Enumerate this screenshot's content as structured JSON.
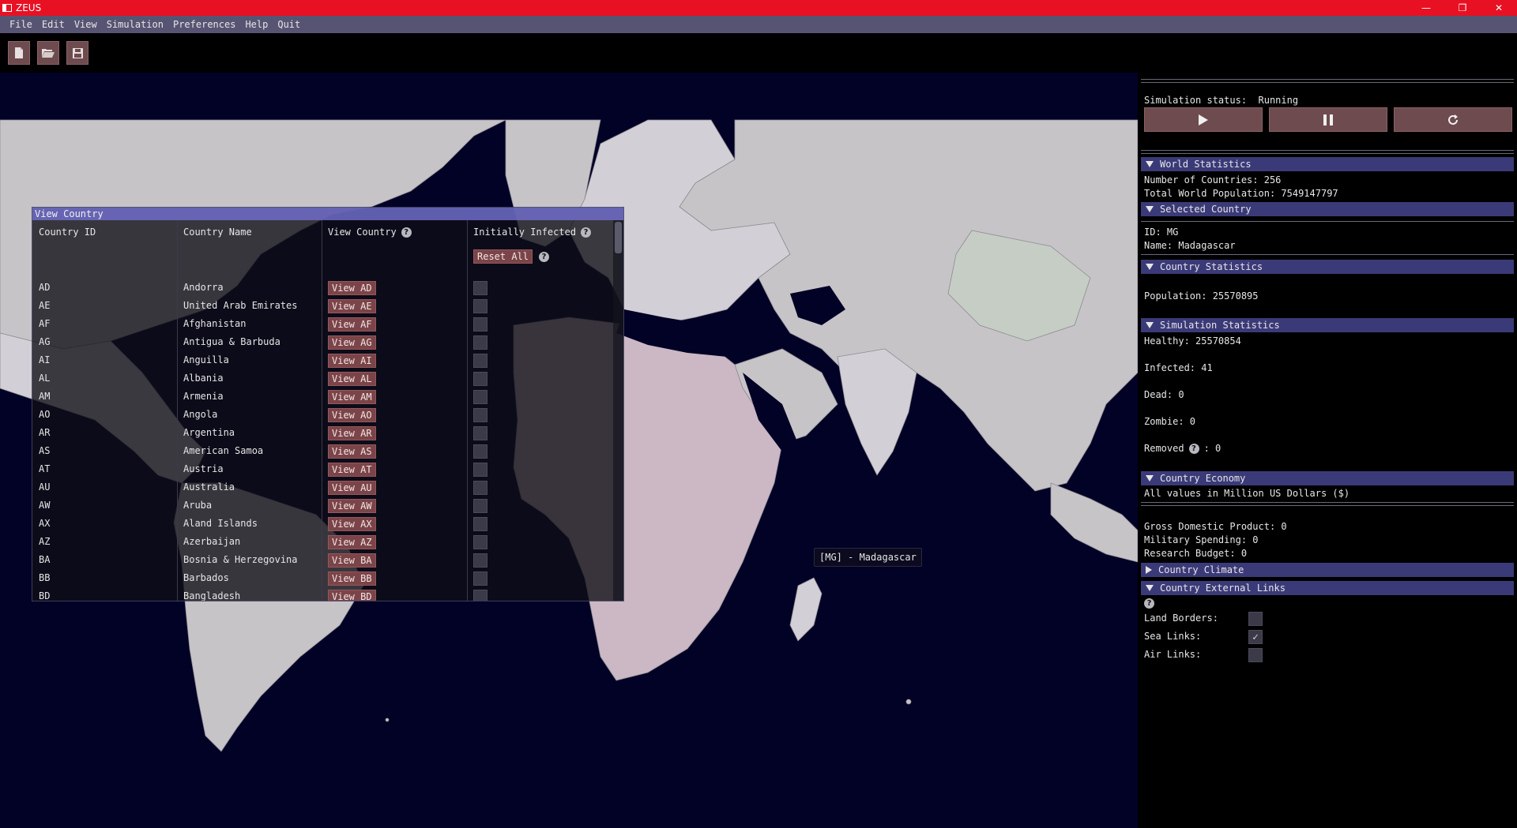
{
  "window": {
    "title": "ZEUS",
    "minimize": "—",
    "restore": "❐",
    "close": "✕"
  },
  "menu": [
    "File",
    "Edit",
    "View",
    "Simulation",
    "Preferences",
    "Help",
    "Quit"
  ],
  "toolbar": {
    "icons": [
      "new-file-icon",
      "open-folder-icon",
      "save-icon"
    ]
  },
  "map": {
    "tooltip": "[MG] - Madagascar"
  },
  "view_country": {
    "title": "View Country",
    "headers": {
      "id": "Country ID",
      "name": "Country Name",
      "view": "View Country",
      "infected": "Initially Infected"
    },
    "reset_all": "Reset All",
    "rows": [
      {
        "id": "AD",
        "name": "Andorra",
        "view": "View AD"
      },
      {
        "id": "AE",
        "name": "United Arab Emirates",
        "view": "View AE"
      },
      {
        "id": "AF",
        "name": "Afghanistan",
        "view": "View AF"
      },
      {
        "id": "AG",
        "name": "Antigua & Barbuda",
        "view": "View AG"
      },
      {
        "id": "AI",
        "name": "Anguilla",
        "view": "View AI"
      },
      {
        "id": "AL",
        "name": "Albania",
        "view": "View AL"
      },
      {
        "id": "AM",
        "name": "Armenia",
        "view": "View AM"
      },
      {
        "id": "AO",
        "name": "Angola",
        "view": "View AO"
      },
      {
        "id": "AR",
        "name": "Argentina",
        "view": "View AR"
      },
      {
        "id": "AS",
        "name": "American Samoa",
        "view": "View AS"
      },
      {
        "id": "AT",
        "name": "Austria",
        "view": "View AT"
      },
      {
        "id": "AU",
        "name": "Australia",
        "view": "View AU"
      },
      {
        "id": "AW",
        "name": "Aruba",
        "view": "View AW"
      },
      {
        "id": "AX",
        "name": "Aland Islands",
        "view": "View AX"
      },
      {
        "id": "AZ",
        "name": "Azerbaijan",
        "view": "View AZ"
      },
      {
        "id": "BA",
        "name": "Bosnia & Herzegovina",
        "view": "View BA"
      },
      {
        "id": "BB",
        "name": "Barbados",
        "view": "View BB"
      },
      {
        "id": "BD",
        "name": "Bangladesh",
        "view": "View BD"
      }
    ]
  },
  "panel": {
    "status_label": "Simulation status:",
    "status_value": "Running",
    "world_stats": {
      "title": "World Statistics",
      "countries": "Number of Countries: 256",
      "population": "Total World Population: 7549147797"
    },
    "selected_country": {
      "title": "Selected Country",
      "id": "ID: MG",
      "name": "Name: Madagascar"
    },
    "country_stats": {
      "title": "Country Statistics",
      "population": "Population: 25570895"
    },
    "sim_stats": {
      "title": "Simulation Statistics",
      "healthy": "Healthy: 25570854",
      "infected": "Infected: 41",
      "dead": "Dead: 0",
      "zombie": "Zombie: 0",
      "removed_label": "Removed",
      "removed_value": ": 0"
    },
    "economy": {
      "title": "Country Economy",
      "note": "All values in Million US Dollars ($)",
      "gdp": "Gross Domestic Product: 0",
      "military": "Military Spending: 0",
      "research": "Research Budget: 0"
    },
    "climate": {
      "title": "Country Climate"
    },
    "links": {
      "title": "Country External Links",
      "land": "Land Borders:",
      "sea": "Sea Links:",
      "air": "Air Links:",
      "land_checked": false,
      "sea_checked": true,
      "air_checked": false
    }
  },
  "colors": {
    "titlebar": "#e81123",
    "menubar": "#575473",
    "section": "#3b3a78",
    "button": "#6e4b4e",
    "ocean": "#020126"
  }
}
